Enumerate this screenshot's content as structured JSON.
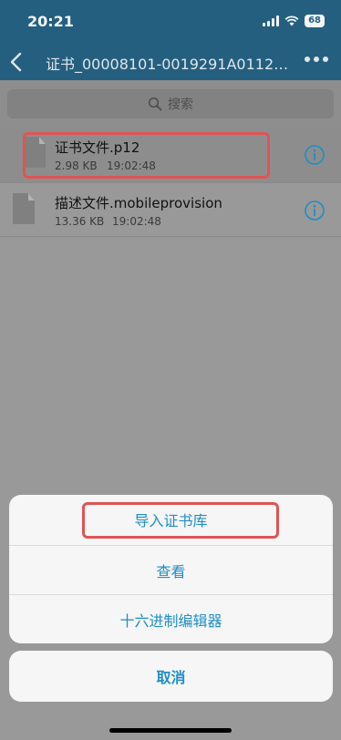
{
  "status_bar": {
    "time": "20:21",
    "battery": "68",
    "bg_color": "#255f7f"
  },
  "nav": {
    "title": "证书_00008101-0019291A01120..."
  },
  "search": {
    "placeholder": "搜索"
  },
  "files": [
    {
      "name": "证书文件.p12",
      "size": "2.98 KB",
      "time": "19:02:48",
      "selected": true
    },
    {
      "name": "描述文件.mobileprovision",
      "size": "13.36 KB",
      "time": "19:02:48",
      "selected": false
    }
  ],
  "action_sheet": {
    "items": [
      "导入证书库",
      "查看",
      "十六进制编辑器"
    ],
    "cancel": "取消"
  },
  "colors": {
    "accent": "#1f8ec5",
    "highlight": "#e05455"
  },
  "icons": [
    "back-chevron-icon",
    "more-dots-icon",
    "search-icon",
    "file-icon",
    "info-icon",
    "signal-icon",
    "wifi-icon",
    "battery-icon"
  ]
}
